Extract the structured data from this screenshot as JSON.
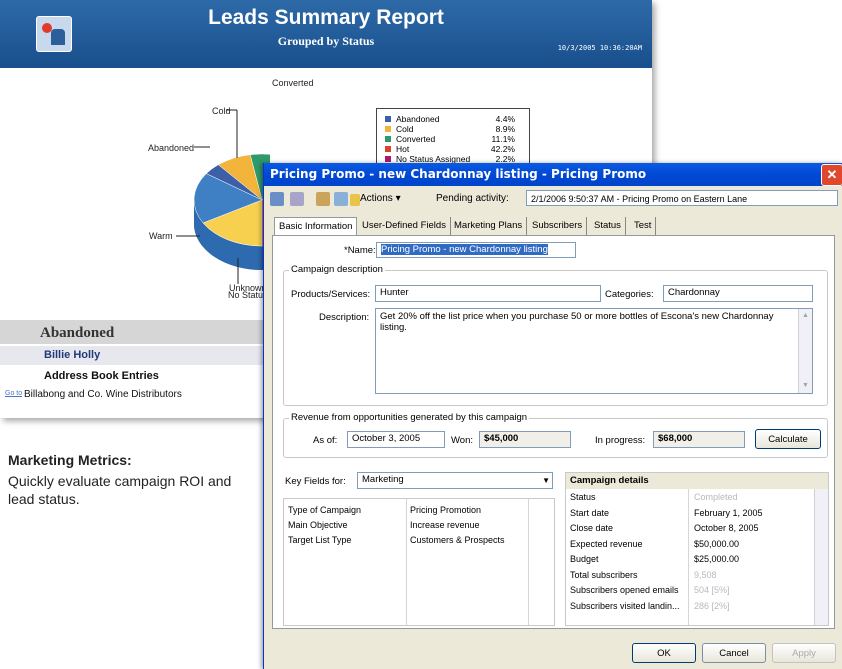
{
  "report": {
    "title": "Leads Summary Report",
    "subtitle": "Grouped by Status",
    "datetime": "10/3/2005 10:36:20AM",
    "section_title": "Abandoned",
    "rows": {
      "contact": "Billie Holly",
      "group": "Address Book Entries",
      "goto": "Go to",
      "company": "Billabong and Co. Wine Distributors"
    }
  },
  "chart_data": {
    "type": "pie",
    "title": "",
    "slice_labels": [
      "Converted",
      "Cold",
      "Abandoned",
      "Warm",
      "Unknown",
      "No Status"
    ],
    "legend": [
      {
        "name": "Abandoned",
        "value": "4.4%",
        "color": "#3d5fa8"
      },
      {
        "name": "Cold",
        "value": "8.9%",
        "color": "#f2b43a"
      },
      {
        "name": "Converted",
        "value": "11.1%",
        "color": "#2e9a6a"
      },
      {
        "name": "Hot",
        "value": "42.2%",
        "color": "#d9442a"
      },
      {
        "name": "No Status Assigned",
        "value": "2.2%",
        "color": "#b0186e"
      }
    ],
    "colors": {
      "abandoned": "#3d5fa8",
      "cold": "#f2b43a",
      "converted": "#2e9a6a",
      "hot": "#d9442a",
      "no_status": "#b0186e",
      "warm": "#3f7fc4",
      "unknown": "#f6d04e"
    }
  },
  "metrics": {
    "title": "Marketing Metrics:",
    "text": "Quickly evaluate campaign ROI and lead status."
  },
  "dialog": {
    "title": "Pricing Promo - new Chardonnay listing - Pricing Promo",
    "toolbar": {
      "actions_label": "Actions",
      "pending_label": "Pending activity:",
      "pending_value": "2/1/2006 9:50:37 AM - Pricing Promo on Eastern Lane"
    },
    "tabs": [
      "Basic Information",
      "User-Defined Fields",
      "Marketing Plans",
      "Subscribers",
      "Status",
      "Test"
    ],
    "name_label": "*Name:",
    "name_value": "Pricing Promo - new Chardonnay listing",
    "campaign_group": "Campaign description",
    "products_label": "Products/Services:",
    "products_value": "Hunter",
    "categories_label": "Categories:",
    "categories_value": "Chardonnay",
    "description_label": "Description:",
    "description_value": "Get 20% off the list price when you purchase 50 or more bottles of Escona's new Chardonnay listing.",
    "revenue_group": "Revenue from opportunities generated by this campaign",
    "as_of_label": "As of:",
    "as_of_value": "October  3, 2005",
    "won_label": "Won:",
    "won_value": "$45,000",
    "in_progress_label": "In progress:",
    "in_progress_value": "$68,000",
    "calculate_label": "Calculate",
    "key_fields_label": "Key Fields for:",
    "key_fields_value": "Marketing",
    "key_fields": [
      {
        "name": "Type of Campaign",
        "value": "Pricing Promotion"
      },
      {
        "name": "Main Objective",
        "value": "Increase revenue"
      },
      {
        "name": "Target List Type",
        "value": "Customers & Prospects"
      }
    ],
    "campaign_details_title": "Campaign details",
    "campaign_details": [
      {
        "label": "Status",
        "value": "Completed",
        "dim": true
      },
      {
        "label": "Start date",
        "value": "February  1, 2005",
        "dim": false
      },
      {
        "label": "Close date",
        "value": "October  8, 2005",
        "dim": false
      },
      {
        "label": "Expected revenue",
        "value": "$50,000.00",
        "dim": false
      },
      {
        "label": "Budget",
        "value": "$25,000.00",
        "dim": false
      },
      {
        "label": "Total subscribers",
        "value": "9,508",
        "dim": true
      },
      {
        "label": "Subscribers opened emails",
        "value": "504 [5%]",
        "dim": true
      },
      {
        "label": "Subscribers visited landin...",
        "value": "286 [2%]",
        "dim": true
      }
    ],
    "ok_label": "OK",
    "cancel_label": "Cancel",
    "apply_label": "Apply"
  }
}
